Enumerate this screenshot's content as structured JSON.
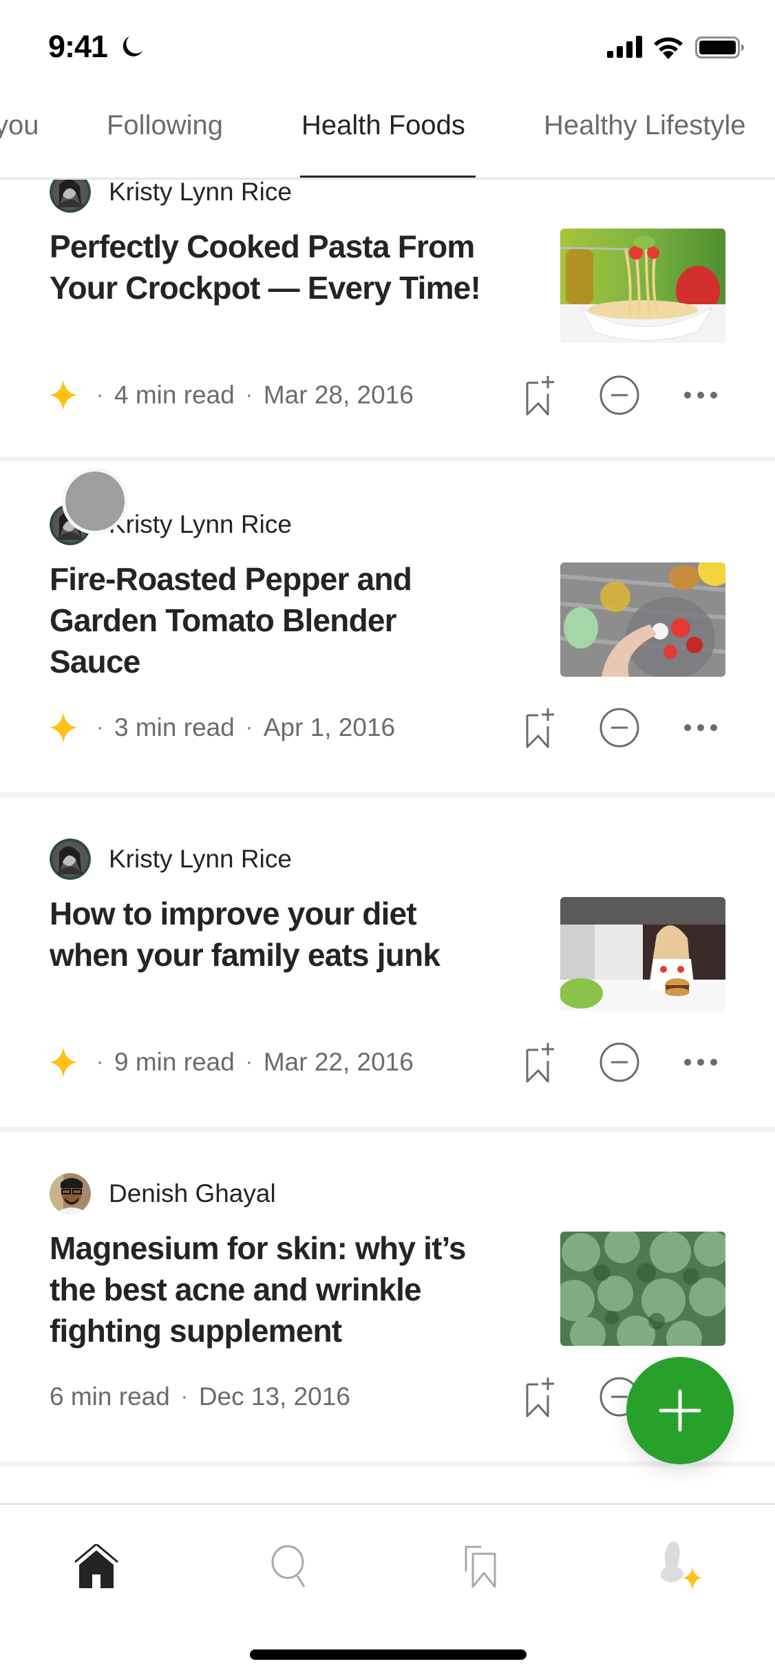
{
  "status_bar": {
    "time": "9:41",
    "focus_icon": "moon-icon",
    "icons": [
      "signal-icon",
      "wifi-icon",
      "battery-icon"
    ]
  },
  "tabs": {
    "items": [
      {
        "label": "you",
        "active": false
      },
      {
        "label": "Following",
        "active": false
      },
      {
        "label": "Health Foods",
        "active": true
      },
      {
        "label": "Healthy Lifestyle",
        "active": false
      }
    ]
  },
  "articles": [
    {
      "author": "Kristy Lynn Rice",
      "title": "Perfectly Cooked Pasta From Your Crockpot — Every Time!",
      "member_only": true,
      "read_time": "4  min read",
      "date": "Mar 28, 2016",
      "thumbnail": "pasta"
    },
    {
      "author": "Kristy Lynn Rice",
      "title": "Fire-Roasted Pepper and Garden Tomato Blender Sauce",
      "member_only": true,
      "read_time": "3  min read",
      "date": "Apr 1, 2016",
      "thumbnail": "blender-vegetables"
    },
    {
      "author": "Kristy Lynn Rice",
      "title": "How to improve your diet when your family eats junk",
      "member_only": true,
      "read_time": "9  min read",
      "date": "Mar 22, 2016",
      "thumbnail": "girl-salad-burger"
    },
    {
      "author": "Denish Ghayal",
      "title": "Magnesium for skin: why it’s the best acne and wrinkle fighting supplement",
      "member_only": false,
      "read_time": "6  min read",
      "date": "Dec 13, 2016",
      "thumbnail": "kale"
    }
  ],
  "meta_separator": "·",
  "fab": {
    "icon": "plus-icon",
    "color": "#27A12A"
  },
  "bottom_nav": {
    "items": [
      {
        "icon": "home-icon",
        "active": true
      },
      {
        "icon": "search-icon",
        "active": false
      },
      {
        "icon": "bookmarks-icon",
        "active": false
      },
      {
        "icon": "profile-icon",
        "active": false
      }
    ]
  },
  "colors": {
    "text_primary": "#242424",
    "text_secondary": "#6B6B6B",
    "member_star": "#FFC017",
    "accent_green": "#27A12A"
  }
}
